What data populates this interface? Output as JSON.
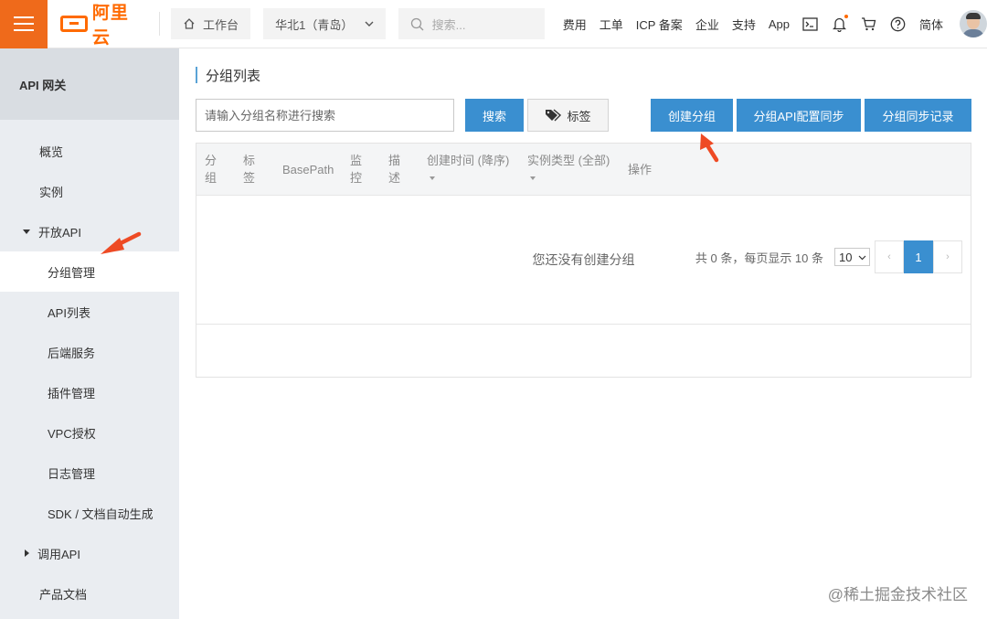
{
  "header": {
    "logo_text": "阿里云",
    "workbench_label": "工作台",
    "region_label": "华北1（青岛）",
    "search_placeholder": "搜索...",
    "nav": [
      "费用",
      "工单",
      "ICP 备案",
      "企业",
      "支持",
      "App"
    ],
    "lang_label": "简体",
    "brand_color": "#ff6a00"
  },
  "sidebar": {
    "title": "API 网关",
    "items": [
      {
        "label": "概览"
      },
      {
        "label": "实例"
      },
      {
        "label": "开放API",
        "expanded": true
      },
      {
        "label": "分组管理",
        "active": true
      },
      {
        "label": "API列表"
      },
      {
        "label": "后端服务"
      },
      {
        "label": "插件管理"
      },
      {
        "label": "VPC授权"
      },
      {
        "label": "日志管理"
      },
      {
        "label": "SDK / 文档自动生成"
      },
      {
        "label": "调用API",
        "expanded": false
      },
      {
        "label": "产品文档"
      }
    ]
  },
  "main": {
    "title": "分组列表",
    "search_placeholder": "请输入分组名称进行搜索",
    "search_button": "搜索",
    "tag_button": "标签",
    "create_button": "创建分组",
    "sync_button": "分组API配置同步",
    "record_button": "分组同步记录",
    "columns": [
      "分\n组",
      "标\n签",
      "BasePath",
      "监\n控",
      "描\n述",
      "创建时间 (降序)",
      "实例类型 (全部)",
      "操作"
    ],
    "empty_text": "您还没有创建分组",
    "pagination": {
      "summary": "共 0 条，每页显示 10 条",
      "page_size": "10",
      "current_page": "1",
      "prev": "‹",
      "next": "›"
    }
  },
  "colors": {
    "primary": "#3a8fd0",
    "arrow": "#ee4a24"
  },
  "watermark": "@稀土掘金技术社区"
}
